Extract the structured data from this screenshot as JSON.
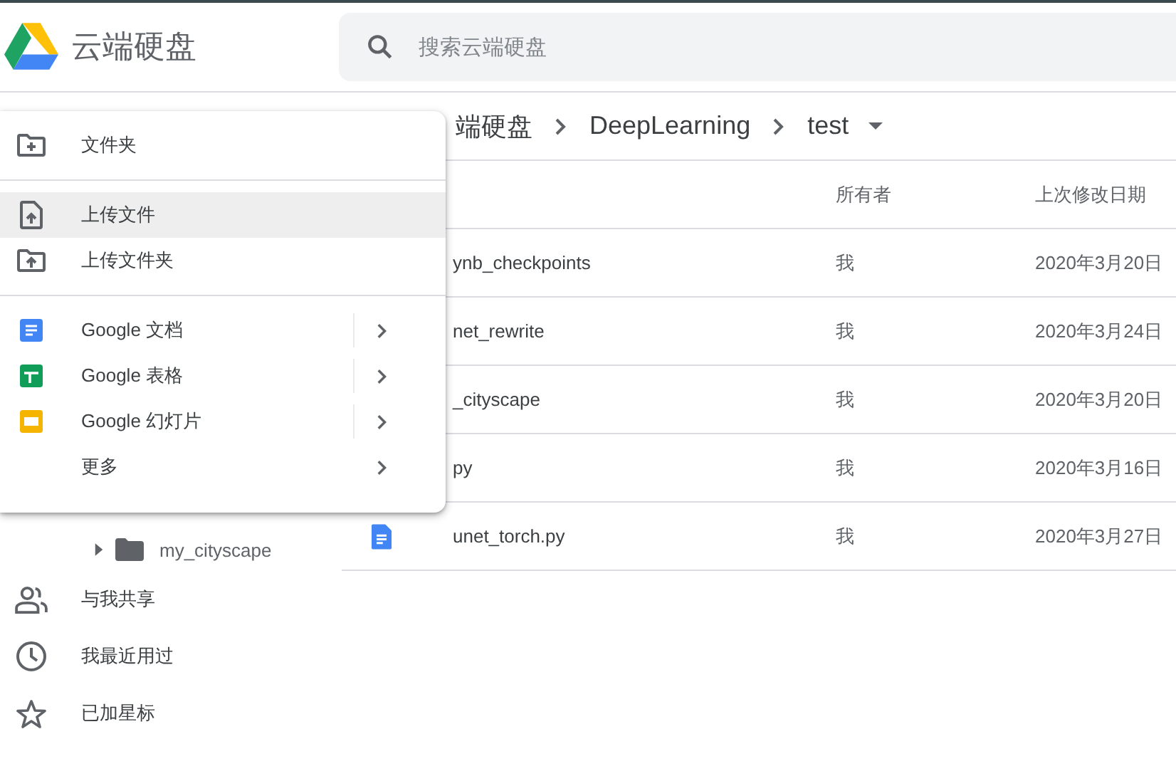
{
  "header": {
    "title": "云端硬盘",
    "search": {
      "placeholder": "搜索云端硬盘"
    }
  },
  "breadcrumb": [
    {
      "label": "端硬盘",
      "dropdown": false
    },
    {
      "label": "DeepLearning",
      "dropdown": false
    },
    {
      "label": "test",
      "dropdown": true
    }
  ],
  "table": {
    "columns": [
      "所有者",
      "上次修改日期"
    ],
    "rows": [
      {
        "name": "ynb_checkpoints",
        "kind": "hidden",
        "owner": "我",
        "modified": "2020年3月20日"
      },
      {
        "name": "net_rewrite",
        "kind": "hidden",
        "owner": "我",
        "modified": "2020年3月24日"
      },
      {
        "name": "_cityscape",
        "kind": "hidden",
        "owner": "我",
        "modified": "2020年3月20日"
      },
      {
        "name": "py",
        "kind": "hidden",
        "owner": "我",
        "modified": "2020年3月16日"
      },
      {
        "name": "unet_torch.py",
        "kind": "doc",
        "owner": "我",
        "modified": "2020年3月27日"
      }
    ]
  },
  "sidebar": {
    "tree": [
      {
        "label": "my_cityscape",
        "expanded": false
      }
    ],
    "items": [
      {
        "kind": "people",
        "label": "与我共享"
      },
      {
        "kind": "clock",
        "label": "我最近用过"
      },
      {
        "kind": "star",
        "label": "已加星标"
      }
    ]
  },
  "menu": {
    "sections": [
      [
        {
          "kind": "new-folder",
          "label": "文件夹",
          "selected": false,
          "submenu": false
        }
      ],
      [
        {
          "kind": "upload-file",
          "label": "上传文件",
          "selected": true,
          "submenu": false
        },
        {
          "kind": "upload-folder",
          "label": "上传文件夹",
          "selected": false,
          "submenu": false
        }
      ],
      [
        {
          "kind": "docs",
          "label": "Google 文档",
          "selected": false,
          "submenu": true
        },
        {
          "kind": "sheets",
          "label": "Google 表格",
          "selected": false,
          "submenu": true
        },
        {
          "kind": "slides",
          "label": "Google 幻灯片",
          "selected": false,
          "submenu": true
        },
        {
          "kind": "more",
          "label": "更多",
          "selected": false,
          "submenu": true
        }
      ]
    ]
  }
}
